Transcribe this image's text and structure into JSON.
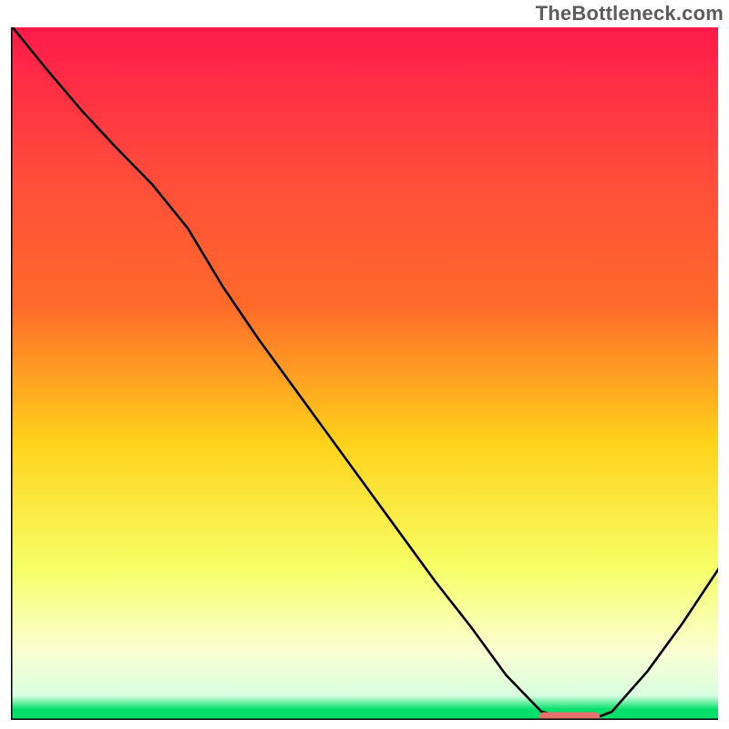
{
  "watermark": "TheBottleneck.com",
  "colors": {
    "gradient_top": "#ff1a4b",
    "gradient_upper_mid": "#ff6a2a",
    "gradient_mid": "#ffd21a",
    "gradient_lower_mid": "#f6ff66",
    "gradient_low": "#fbffd2",
    "gradient_bottom": "#00e06a",
    "axis": "#000000",
    "curve": "#000000",
    "marker_fill": "#e6716f",
    "marker_stroke": "#e6716f"
  },
  "chart_data": {
    "type": "line",
    "title": "",
    "xlabel": "",
    "ylabel": "",
    "xlim": [
      0,
      100
    ],
    "ylim": [
      0,
      100
    ],
    "grid": false,
    "legend": false,
    "annotations": [],
    "series": [
      {
        "name": "bottleneck-curve",
        "x": [
          0,
          5,
          10,
          15,
          20,
          25,
          30,
          35,
          40,
          45,
          50,
          55,
          60,
          65,
          70,
          75,
          80,
          82,
          85,
          90,
          95,
          100.2
        ],
        "y": [
          100.3,
          94,
          88,
          82.5,
          77.3,
          71,
          62.5,
          55,
          48,
          41,
          34,
          27,
          20,
          13.5,
          6.5,
          1.2,
          0,
          0,
          1.2,
          7,
          14,
          22
        ]
      }
    ],
    "marker": {
      "name": "optimal-region",
      "shape": "rounded-bar",
      "x_center": 79,
      "y_center": 0.35,
      "width": 8.5,
      "height": 1.4
    }
  }
}
